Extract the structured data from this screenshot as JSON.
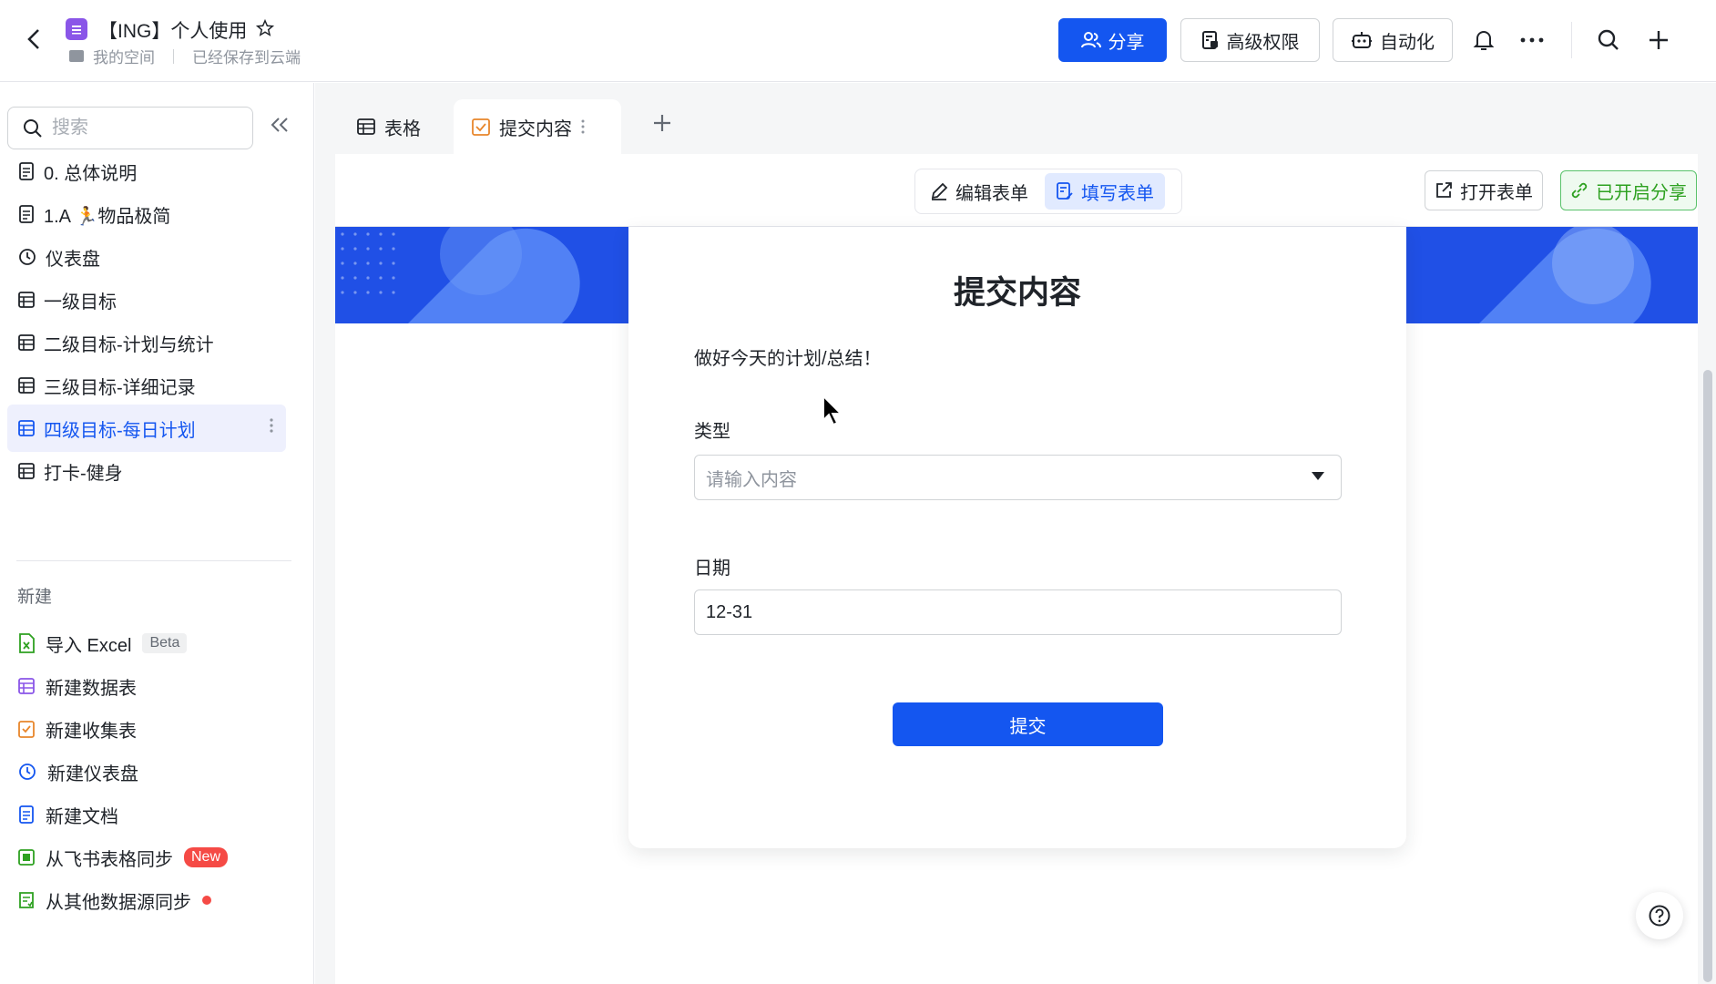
{
  "header": {
    "doc_title": "【ING】个人使用",
    "location": "我的空间",
    "save_status": "已经保存到云端",
    "share_label": "分享",
    "permissions_label": "高级权限",
    "automation_label": "自动化"
  },
  "sidebar": {
    "search_placeholder": "搜索",
    "items": [
      {
        "label": "0. 总体说明",
        "icon": "doc-icon"
      },
      {
        "label": "1.A 🏃物品极简",
        "icon": "doc-icon"
      },
      {
        "label": "仪表盘",
        "icon": "dashboard-icon"
      },
      {
        "label": "一级目标",
        "icon": "table-icon"
      },
      {
        "label": "二级目标-计划与统计",
        "icon": "table-icon"
      },
      {
        "label": "三级目标-详细记录",
        "icon": "table-icon"
      },
      {
        "label": "四级目标-每日计划",
        "icon": "table-icon",
        "active": true
      },
      {
        "label": "打卡-健身",
        "icon": "table-icon"
      }
    ],
    "new_section_label": "新建",
    "new_items": [
      {
        "label": "导入 Excel",
        "badge": "Beta",
        "icon": "excel-icon"
      },
      {
        "label": "新建数据表",
        "icon": "table-icon"
      },
      {
        "label": "新建收集表",
        "icon": "form-icon"
      },
      {
        "label": "新建仪表盘",
        "icon": "dashboard-icon"
      },
      {
        "label": "新建文档",
        "icon": "doc-icon"
      },
      {
        "label": "从飞书表格同步",
        "badge": "New",
        "icon": "sheet-icon"
      },
      {
        "label": "从其他数据源同步",
        "icon": "sync-icon"
      }
    ]
  },
  "tabs": [
    {
      "label": "表格",
      "icon": "grid-icon"
    },
    {
      "label": "提交内容",
      "icon": "form-icon",
      "active": true
    }
  ],
  "toolbar": {
    "edit_form_label": "编辑表单",
    "fill_form_label": "填写表单",
    "open_form_label": "打开表单",
    "sharing_enabled_label": "已开启分享"
  },
  "form": {
    "title": "提交内容",
    "description": "做好今天的计划/总结！",
    "fields": [
      {
        "label": "类型",
        "placeholder": "请输入内容",
        "type": "select"
      },
      {
        "label": "日期",
        "value": "12-31",
        "type": "date"
      }
    ],
    "submit_label": "提交"
  },
  "colors": {
    "primary": "#1456f0",
    "banner": "#2050e6",
    "success": "#2ea121",
    "app_icon": "#8a56e8"
  }
}
